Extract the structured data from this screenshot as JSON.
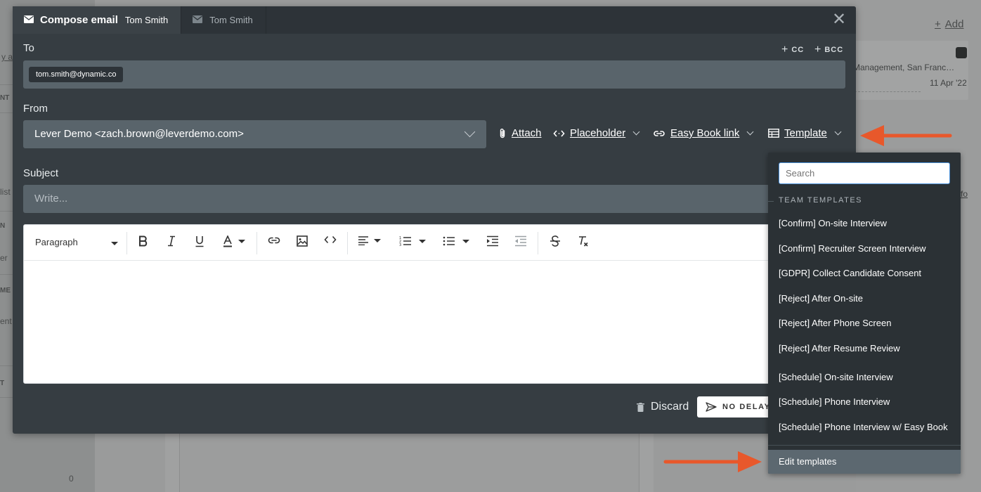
{
  "background": {
    "left_fragments": [
      "y all",
      "NT",
      "list",
      "N",
      "er",
      "ME",
      "ent",
      "T",
      "0"
    ],
    "add_label": "Add",
    "card_location": "Management, San Franc…",
    "card_date": "11 Apr '22",
    "side_link": "fo"
  },
  "modal": {
    "tab_active": {
      "title": "Compose email",
      "candidate": "Tom Smith"
    },
    "tab_inactive": {
      "candidate": "Tom Smith"
    },
    "to_label": "To",
    "cc_label": "CC",
    "bcc_label": "BCC",
    "to_chip": "tom.smith@dynamic.co",
    "from_label": "From",
    "from_value": "Lever Demo <zach.brown@leverdemo.com>",
    "actions": {
      "attach": "Attach",
      "placeholder": "Placeholder",
      "easy_book": "Easy Book link",
      "template": "Template"
    },
    "subject_label": "Subject",
    "subject_placeholder": "Write...",
    "toolbar": {
      "paragraph": "Paragraph"
    },
    "discard_label": "Discard",
    "send_label": "NO DELAY"
  },
  "template_dropdown": {
    "search_placeholder": "Search",
    "section_title": "TEAM TEMPLATES",
    "items": [
      "[Confirm] On-site Interview",
      "[Confirm] Recruiter Screen Interview",
      "[GDPR] Collect Candidate Consent",
      "[Reject] After On-site",
      "[Reject] After Phone Screen",
      "[Reject] After Resume Review",
      "[Schedule] On-site Interview",
      "[Schedule] Phone Interview",
      "[Schedule] Phone Interview w/ Easy Book"
    ],
    "edit_label": "Edit templates"
  },
  "colors": {
    "annotation_arrow": "#e8582b",
    "modal_bg": "#363d42",
    "field_bg": "#59646b",
    "dropdown_bg": "#2b3135",
    "edit_row_bg": "#5c6870"
  }
}
